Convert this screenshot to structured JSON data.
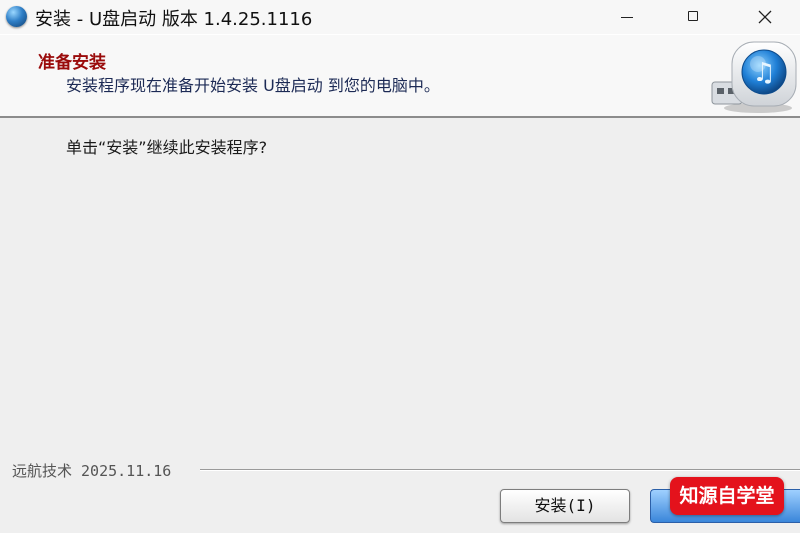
{
  "window": {
    "title": "安装 - U盘启动 版本 1.4.25.1116",
    "app_icon": "app-disc-icon",
    "controls": {
      "minimize_icon": "minimize-icon",
      "maximize_icon": "maximize-icon",
      "close_icon": "close-icon"
    }
  },
  "header": {
    "title": "准备安装",
    "subtitle": "安装程序现在准备开始安装 U盘启动 到您的电脑中。",
    "logo_icon": "usb-music-drive-icon",
    "title_color": "#9a0b0b"
  },
  "content": {
    "instruction": "单击“安装”继续此安装程序?"
  },
  "footer": {
    "brand": "远航技术 2025.11.16",
    "install_button": "安装(I)",
    "next_button_color": "#3a86da"
  },
  "watermark": {
    "text": "知源自学堂",
    "color": "#e4121c"
  }
}
